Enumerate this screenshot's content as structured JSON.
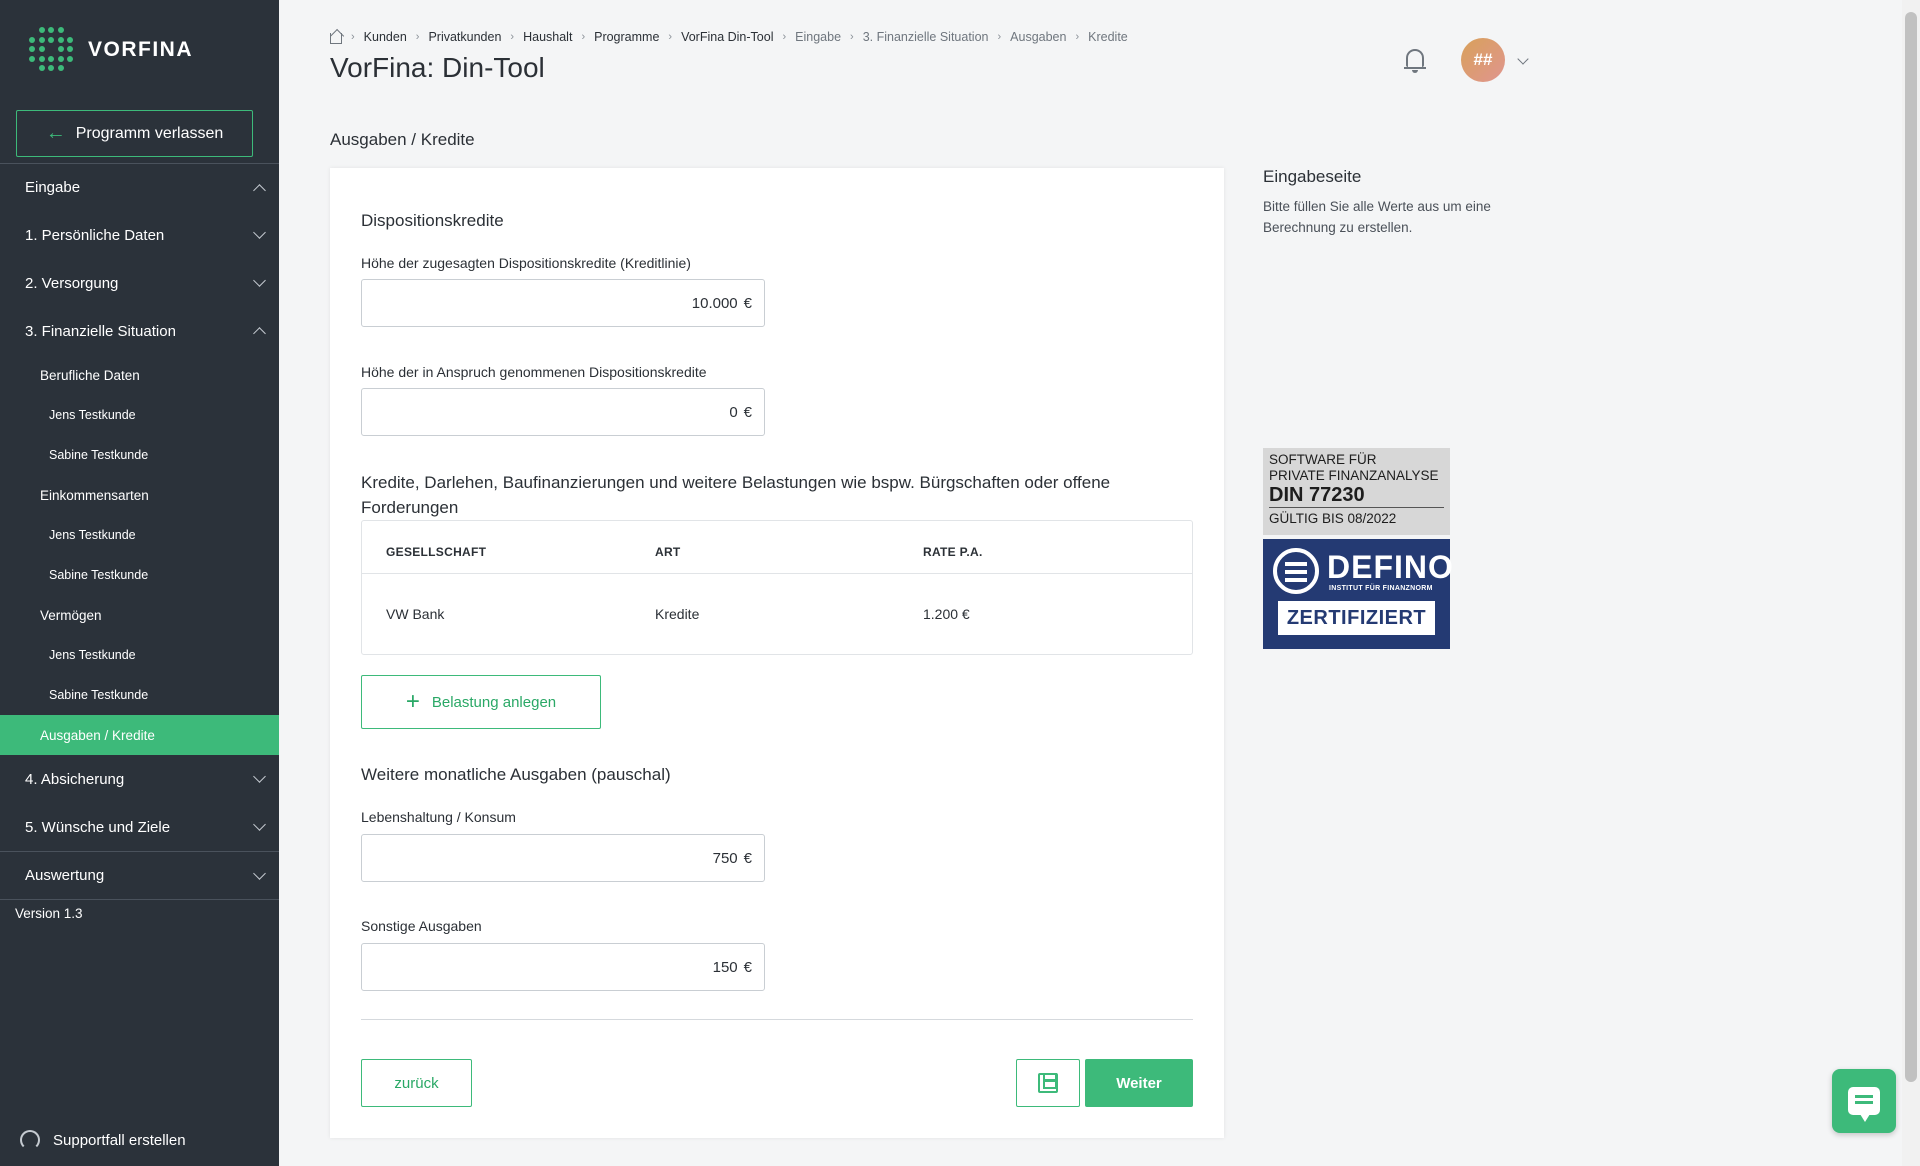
{
  "brand": {
    "name": "VORFINA",
    "accent": "#3dba7a",
    "sidebar_bg": "#2b323a"
  },
  "sidebar": {
    "exit_label": "Programm verlassen",
    "items": [
      {
        "label": "Eingabe"
      },
      {
        "label": "1. Persönliche Daten"
      },
      {
        "label": "2. Versorgung"
      },
      {
        "label": "3. Finanzielle Situation"
      },
      {
        "label": "Berufliche Daten"
      },
      {
        "label": "Jens Testkunde"
      },
      {
        "label": "Sabine Testkunde"
      },
      {
        "label": "Einkommensarten"
      },
      {
        "label": "Jens Testkunde"
      },
      {
        "label": "Sabine Testkunde"
      },
      {
        "label": "Vermögen"
      },
      {
        "label": "Jens Testkunde"
      },
      {
        "label": "Sabine Testkunde"
      },
      {
        "label": "Ausgaben / Kredite"
      },
      {
        "label": "4. Absicherung"
      },
      {
        "label": "5. Wünsche und Ziele"
      },
      {
        "label": "Auswertung"
      }
    ],
    "version": "Version 1.3",
    "support": "Supportfall erstellen"
  },
  "header": {
    "breadcrumb": [
      "Kunden",
      "Privatkunden",
      "Haushalt",
      "Programme",
      "VorFina Din-Tool",
      "Eingabe",
      "3. Finanzielle Situation",
      "Ausgaben",
      "Kredite"
    ],
    "title": "VorFina: Din-Tool",
    "avatar": "##"
  },
  "main": {
    "section_heading": "Ausgaben / Kredite",
    "dispo": {
      "heading": "Dispositionskredite",
      "limit_label": "Höhe der zugesagten Dispositionskredite (Kreditlinie)",
      "limit_value": "10.000",
      "used_label": "Höhe der in Anspruch genommenen Dispositionskredite",
      "used_value": "0",
      "currency": "€"
    },
    "loans": {
      "heading": "Kredite, Darlehen, Baufinanzierungen und weitere Belastungen wie bspw. Bürgschaften oder offene Forderungen",
      "columns": [
        "GESELLSCHAFT",
        "ART",
        "RATE P.A."
      ],
      "rows": [
        [
          "VW Bank",
          "Kredite",
          "1.200 €"
        ]
      ],
      "add_label": "Belastung anlegen"
    },
    "expenses": {
      "heading": "Weitere monatliche Ausgaben (pauschal)",
      "living_label": "Lebenshaltung / Konsum",
      "living_value": "750",
      "other_label": "Sonstige Ausgaben",
      "other_value": "150"
    },
    "back_label": "zurück",
    "next_label": "Weiter"
  },
  "info": {
    "title": "Eingabeseite",
    "text": "Bitte füllen Sie alle Werte aus um eine Berechnung zu erstellen."
  },
  "seal": {
    "line1": "SOFTWARE FÜR",
    "line2": "PRIVATE FINANZANALYSE",
    "norm": "DIN 77230",
    "valid": "GÜLTIG BIS 08/2022",
    "brand": "DEFINO",
    "institute": "INSTITUT FÜR FINANZNORM",
    "certified": "ZERTIFIZIERT"
  }
}
